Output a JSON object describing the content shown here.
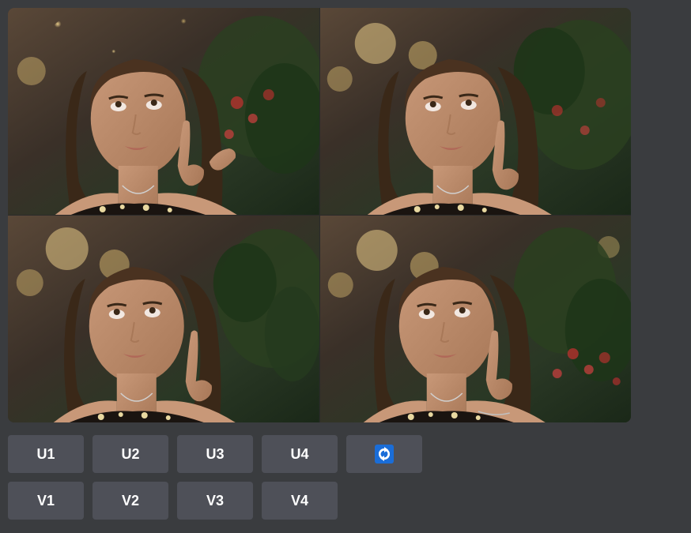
{
  "upscale_buttons": {
    "u1": "U1",
    "u2": "U2",
    "u3": "U3",
    "u4": "U4"
  },
  "variation_buttons": {
    "v1": "V1",
    "v2": "V2",
    "v3": "V3",
    "v4": "V4"
  },
  "icons": {
    "reroll": "refresh-icon"
  },
  "image_grid": {
    "quadrants": [
      "q1",
      "q2",
      "q3",
      "q4"
    ]
  }
}
